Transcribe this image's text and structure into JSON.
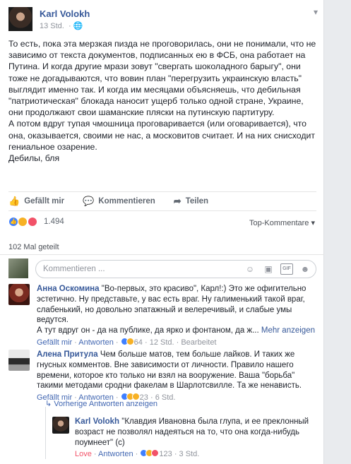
{
  "post": {
    "author": "Karl Volokh",
    "time": "13 Std.",
    "paragraphs": [
      "То есть, пока эта мерзкая пизда не проговорилась, они не понимали, что не зависимо от текста документов, подписанных ею в ФСБ, она работает на Путина. И когда другие мрази зовут \"свергать шоколадного барыгу\", они тоже не догадываются, что вовин план \"перегрузить украинскую власть\" выглядит именно так. И когда им месяцами объясняешь, что дебильная \"патриотическая\" блокада наносит ущерб только одной стране, Украине, они продолжают свои шаманские пляски на путинскую партитуру.",
      "А потом вдруг тупая чмошница проговаривается (или оговаривается), что она, оказывается, своими не нас, а московитов считает. И на них снисходит гениальное озарение.",
      "Дебилы, бля"
    ]
  },
  "actions": {
    "like": "Gefällt mir",
    "comment": "Kommentieren",
    "share": "Teilen"
  },
  "reactions": {
    "count": "1.494",
    "sort": "Top-Kommentare",
    "shares": "102 Mal geteilt"
  },
  "composer": {
    "placeholder": "Kommentieren ..."
  },
  "comments": [
    {
      "name": "Анна Оскомина",
      "text": "\"Во-первых, это красиво\", Карл!:) Это же офигительно эстетично. Ну представьте, у вас есть враг. Ну галименький такой враг, слабенький, но довольно эпатажный и велеречивый, и слабые умы ведутся.",
      "text2": "А тут вдруг он - да на публике, да ярко и фонтаном, да ж...",
      "more": "Mehr anzeigen",
      "like": "Gefällt mir",
      "reply": "Antworten",
      "reacts": "64",
      "time": "12 Std.",
      "edited": "Bearbeitet"
    },
    {
      "name": "Алена Притула",
      "text": "Чем больше матов, тем больше лайков. И таких же гнусных комментов. Вне зависимости от личности. Правило нашего времени, которое кто только ни взял на вооружение. Ваша \"борьба\" такими методами сродни факелам в Шарлотсвилле. Та же ненависть.",
      "like": "Gefällt mir",
      "reply": "Antworten",
      "reacts": "23",
      "time": "6 Std."
    }
  ],
  "thread": {
    "previous": "Vorherige Antworten anzeigen",
    "reply": {
      "name": "Karl Volokh",
      "text": "\"Клавдия Ивановна была глупа, и ее преклонный возраст не позволял надеяться на то, что она когда-нибудь поумнеет\" (с)",
      "love": "Love",
      "reply": "Antworten",
      "reacts": "123",
      "time": "3 Std."
    }
  }
}
